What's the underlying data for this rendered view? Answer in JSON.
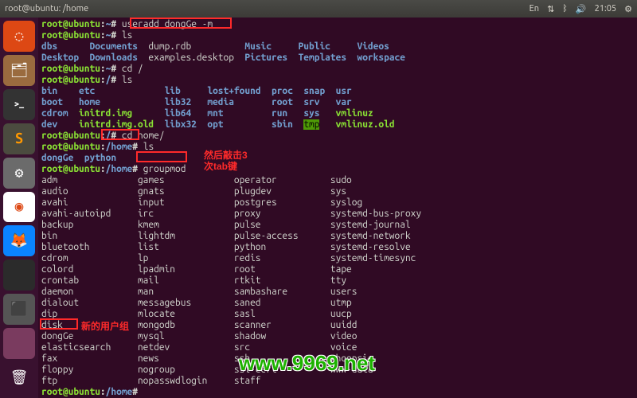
{
  "topbar": {
    "title": "root@ubuntu: /home",
    "time": "21:05",
    "lang": "En"
  },
  "launcher": {
    "items": [
      {
        "name": "ubuntu-dash",
        "bg": "#dd4814",
        "glyph": "◌"
      },
      {
        "name": "files",
        "bg": "#9a6b3f",
        "glyph": "🗂"
      },
      {
        "name": "terminal",
        "bg": "#333333",
        "glyph": ">_"
      },
      {
        "name": "sublime",
        "bg": "#4b4b3f",
        "glyph": "S"
      },
      {
        "name": "settings",
        "bg": "#6b6b6b",
        "glyph": "⚙"
      },
      {
        "name": "chrome",
        "bg": "#ffffff",
        "glyph": "◉"
      },
      {
        "name": "firefox",
        "bg": "#0a84ff",
        "glyph": "🦊"
      },
      {
        "name": "blank1",
        "bg": "#2b2b2b",
        "glyph": ""
      },
      {
        "name": "software",
        "bg": "#555555",
        "glyph": "⬛"
      },
      {
        "name": "blank2",
        "bg": "#7a3b5f",
        "glyph": ""
      }
    ],
    "trash": {
      "name": "trash",
      "bg": "transparent",
      "glyph": "🗑"
    }
  },
  "prompt": {
    "userhost": "root@ubuntu",
    "home_path": "~",
    "root_path": "/",
    "home_dir_path": "/home"
  },
  "cmds": {
    "useradd": "useradd dongGe -m",
    "ls": "ls",
    "cd_root": "cd /",
    "cd_home": "cd home/",
    "groupmod": "groupmod"
  },
  "ls_home_user": {
    "row1": [
      "dbs",
      "Documents",
      "dump.rdb",
      "Music",
      "Public",
      "Videos"
    ],
    "row2": [
      "Desktop",
      "Downloads",
      "examples.desktop",
      "Pictures",
      "Templates",
      "workspace"
    ]
  },
  "ls_root": [
    {
      "c1": "bin",
      "c2": "etc",
      "c3": "lib",
      "c4": "lost+found",
      "c5": "proc",
      "c6": "snap",
      "c7": "usr"
    },
    {
      "c1": "boot",
      "c2": "home",
      "c3": "lib32",
      "c4": "media",
      "c5": "root",
      "c6": "srv",
      "c7": "var"
    },
    {
      "c1": "cdrom",
      "c2": "initrd.img",
      "c3": "lib64",
      "c4": "mnt",
      "c5": "run",
      "c6": "sys",
      "c7": "vmlinuz",
      "c2class": "exec",
      "c7class": "exec"
    },
    {
      "c1": "dev",
      "c2": "initrd.img.old",
      "c3": "libx32",
      "c4": "opt",
      "c5": "sbin",
      "c6": "tmp",
      "c7": "vmlinuz.old",
      "c2class": "exec",
      "c6class": "sticky",
      "c7class": "exec"
    }
  ],
  "ls_home": [
    "dongGe",
    "python"
  ],
  "groups": {
    "col1": [
      "adm",
      "audio",
      "avahi",
      "avahi-autoipd",
      "backup",
      "bin",
      "bluetooth",
      "cdrom",
      "colord",
      "crontab",
      "daemon",
      "dialout",
      "dip",
      "disk",
      "dongGe",
      "elasticsearch",
      "fax",
      "floppy",
      "ftp"
    ],
    "col2": [
      "games",
      "gnats",
      "input",
      "irc",
      "kmem",
      "lightdm",
      "list",
      "lp",
      "lpadmin",
      "mail",
      "man",
      "messagebus",
      "mlocate",
      "mongodb",
      "mysql",
      "netdev",
      "news",
      "nogroup",
      "nopasswdlogin"
    ],
    "col3": [
      "operator",
      "plugdev",
      "postgres",
      "proxy",
      "pulse",
      "pulse-access",
      "python",
      "redis",
      "root",
      "rtkit",
      "sambashare",
      "saned",
      "sasl",
      "scanner",
      "shadow",
      "src",
      "ssh",
      "ssl-cert",
      "staff"
    ],
    "col4": [
      "sudo",
      "sys",
      "syslog",
      "systemd-bus-proxy",
      "systemd-journal",
      "systemd-network",
      "systemd-resolve",
      "systemd-timesync",
      "tape",
      "tty",
      "users",
      "utmp",
      "uucp",
      "uuidd",
      "video",
      "voice",
      "whoopsie",
      "www-data"
    ]
  },
  "annotations": {
    "tab_hint_1": "然后敲击3",
    "tab_hint_2": "次tab键",
    "new_group": "新的用户组"
  },
  "watermark": "www.9969.net"
}
